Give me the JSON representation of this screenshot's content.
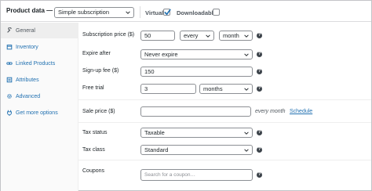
{
  "header": {
    "title": "Product data —",
    "product_type": "Simple subscription",
    "virtual_label": "Virtual:",
    "virtual_checked": true,
    "downloadable_label": "Downloadable:",
    "downloadable_checked": false
  },
  "sidebar": {
    "items": [
      {
        "label": "General",
        "icon": "wrench-icon",
        "active": true
      },
      {
        "label": "Inventory",
        "icon": "inventory-icon",
        "active": false
      },
      {
        "label": "Linked Products",
        "icon": "link-icon",
        "active": false
      },
      {
        "label": "Attributes",
        "icon": "attributes-icon",
        "active": false
      },
      {
        "label": "Advanced",
        "icon": "gear-icon",
        "active": false
      },
      {
        "label": "Get more options",
        "icon": "plugin-icon",
        "active": false
      }
    ]
  },
  "fields": {
    "subscription_price": {
      "label": "Subscription price ($)",
      "value": "50",
      "interval": "every",
      "period": "month"
    },
    "expire_after": {
      "label": "Expire after",
      "value": "Never expire"
    },
    "signup_fee": {
      "label": "Sign-up fee ($)",
      "value": "150"
    },
    "free_trial": {
      "label": "Free trial",
      "value": "3",
      "period": "months"
    },
    "sale_price": {
      "label": "Sale price ($)",
      "value": "",
      "suffix": "every month",
      "schedule_link": "Schedule"
    },
    "tax_status": {
      "label": "Tax status",
      "value": "Taxable"
    },
    "tax_class": {
      "label": "Tax class",
      "value": "Standard"
    },
    "coupons": {
      "label": "Coupons",
      "placeholder": "Search for a coupon…"
    }
  },
  "colors": {
    "link": "#2271b1",
    "border": "#8c8f94",
    "active_tab_bg": "#eeeeee",
    "checkbox_check": "#2271b1"
  }
}
